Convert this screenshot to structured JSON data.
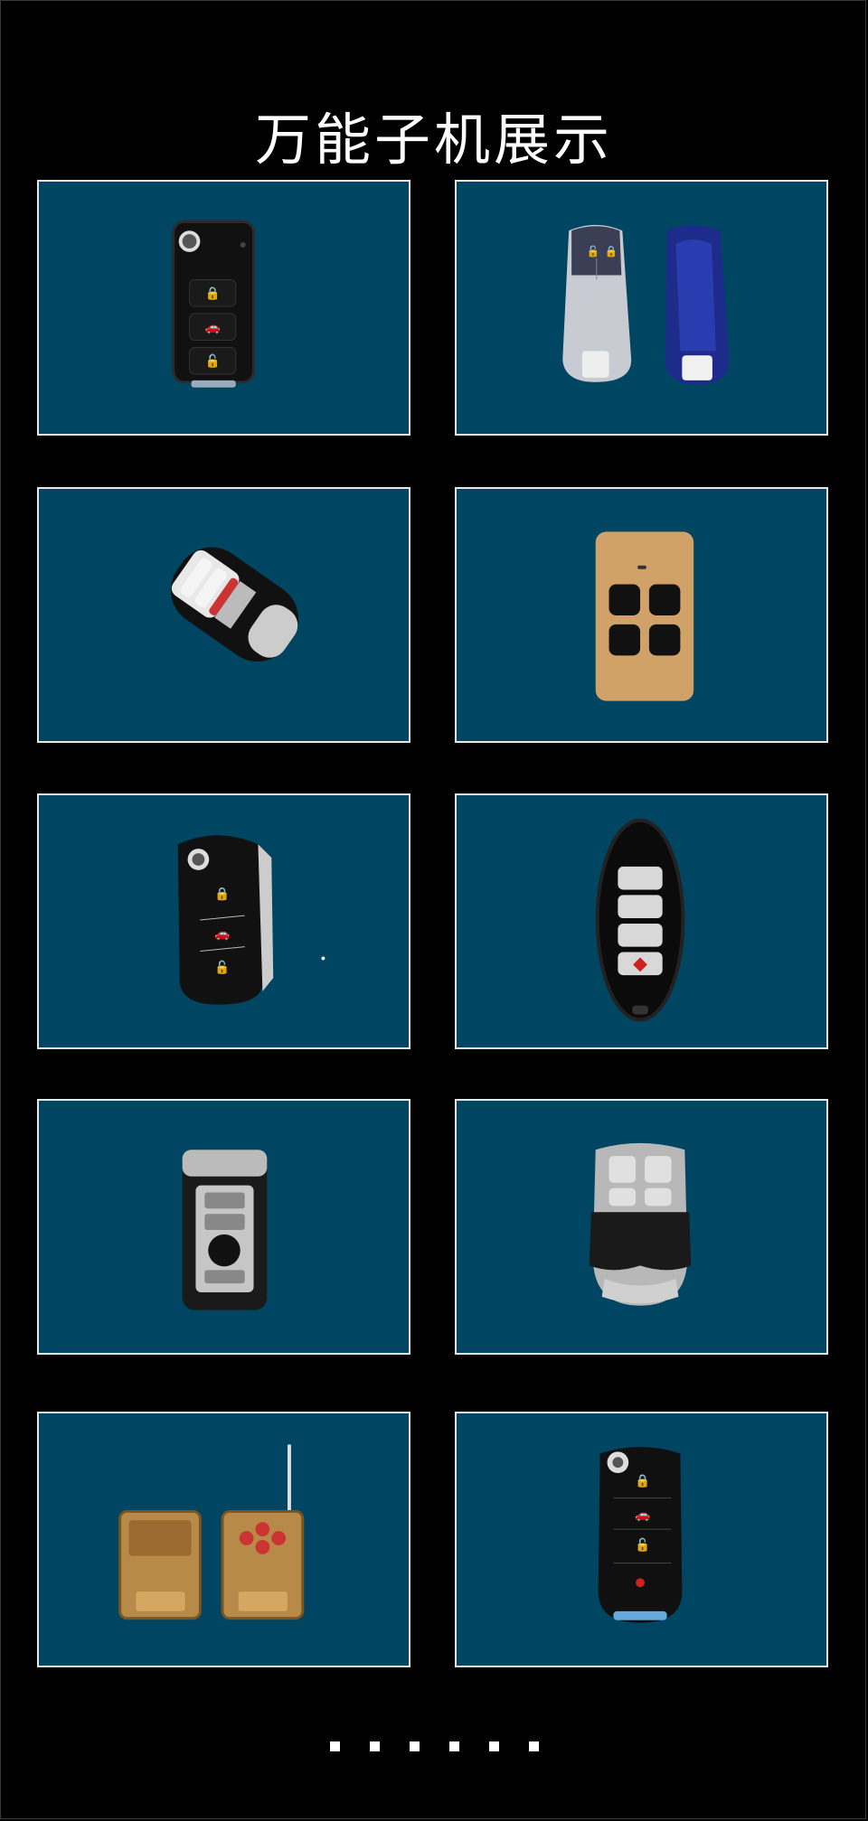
{
  "header": {
    "title": "万能子机展示"
  },
  "gallery": {
    "items": [
      {
        "icon": "flip-key-fob-icon"
      },
      {
        "icon": "smart-key-with-case-icon"
      },
      {
        "icon": "audi-style-smart-key-icon"
      },
      {
        "icon": "garage-remote-icon"
      },
      {
        "icon": "flip-key-remote-icon"
      },
      {
        "icon": "oval-smart-key-icon"
      },
      {
        "icon": "bmw-style-key-icon"
      },
      {
        "icon": "garage-remote-chrome-icon"
      },
      {
        "icon": "antenna-remotes-icon"
      },
      {
        "icon": "ford-style-flip-key-icon"
      }
    ]
  },
  "pagination": {
    "count": 6
  }
}
